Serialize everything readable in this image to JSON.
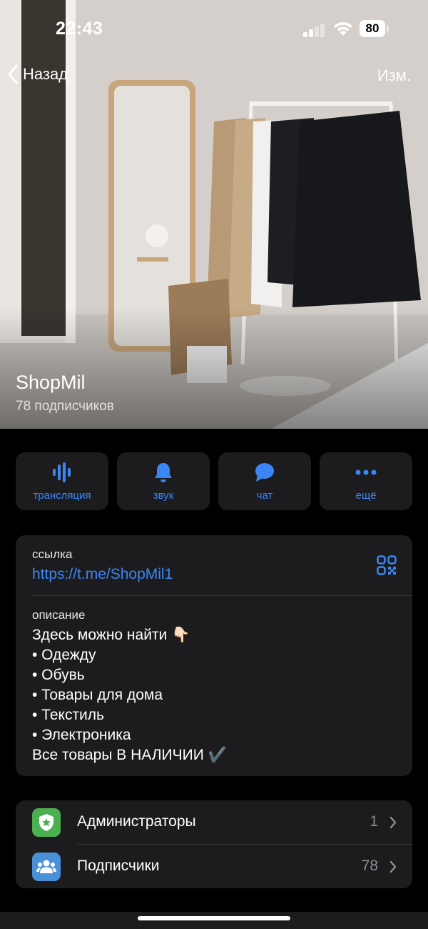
{
  "status_bar": {
    "time": "22:43",
    "battery": "80"
  },
  "nav": {
    "back_label": "Назад",
    "edit_label": "Изм."
  },
  "channel": {
    "name": "ShopMil",
    "subscribers": "78 подписчиков"
  },
  "actions": [
    {
      "label": "трансляция",
      "icon": "broadcast-icon"
    },
    {
      "label": "звук",
      "icon": "bell-icon"
    },
    {
      "label": "чат",
      "icon": "chat-bubble-icon"
    },
    {
      "label": "ещё",
      "icon": "more-icon"
    }
  ],
  "info": {
    "link_label": "ссылка",
    "link_value": "https://t.me/ShopMil1",
    "description_label": "описание",
    "description_lines": [
      "Здесь можно найти 👇🏻",
      "• Одежду",
      "• Обувь",
      "• Товары для дома",
      "• Текстиль",
      "• Электроника",
      "Все товары В НАЛИЧИИ ✔️"
    ]
  },
  "list": [
    {
      "label": "Администраторы",
      "count": "1",
      "icon": "shield-star-icon",
      "color": "#4caf50"
    },
    {
      "label": "Подписчики",
      "count": "78",
      "icon": "people-icon",
      "color": "#4a90d9"
    }
  ],
  "colors": {
    "accent": "#3b86f5",
    "card": "#1c1c1e",
    "background": "#000000"
  }
}
